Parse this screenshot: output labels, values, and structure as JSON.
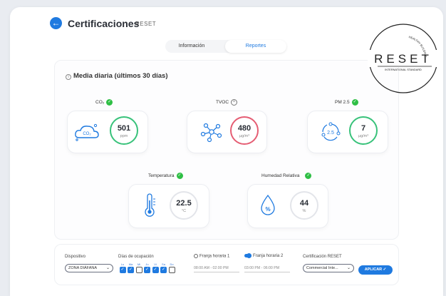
{
  "header": {
    "title": "Certificaciones",
    "subtitle": "RESET",
    "back_icon": "arrow-left-icon"
  },
  "tabs": [
    {
      "label": "Información",
      "active": false
    },
    {
      "label": "Reportes",
      "active": true
    }
  ],
  "section": {
    "title": "Media diaria (últimos 30 días)"
  },
  "metrics": {
    "co2": {
      "label": "CO₂",
      "value": "501",
      "unit": "ppm",
      "status": "ok",
      "icon": "cloud-co2-icon"
    },
    "tvoc": {
      "label": "TVOC",
      "value": "480",
      "unit": "µg/m³",
      "status": "fail",
      "icon": "molecule-icon"
    },
    "pm25": {
      "label": "PM 2.5",
      "value": "7",
      "unit": "µg/m³",
      "status": "ok",
      "icon": "particles-icon",
      "icon_text": "2.5"
    },
    "temp": {
      "label": "Temperatura",
      "value": "22.5",
      "unit": "°C",
      "status": "ok",
      "icon": "thermometer-icon"
    },
    "humidity": {
      "label": "Humedad Relativa",
      "value": "44",
      "unit": "%",
      "status": "ok",
      "icon": "water-drop-icon",
      "icon_text": "%"
    }
  },
  "filters": {
    "device_label": "Dispositivo",
    "device_value": "ZONA DIÁFANA",
    "days_label": "Días de ocupación",
    "days": [
      {
        "d": "Lu",
        "checked": true
      },
      {
        "d": "Ma",
        "checked": true
      },
      {
        "d": "Mi",
        "checked": false
      },
      {
        "d": "Ju",
        "checked": true
      },
      {
        "d": "Vi",
        "checked": true
      },
      {
        "d": "Sa",
        "checked": true
      },
      {
        "d": "Do",
        "checked": false
      }
    ],
    "slot1_label": "Franja horaria 1",
    "slot1_value": "08:00 AM - 02:00 PM",
    "slot2_label": "Franja horaria  2",
    "slot2_value": "03:00 PM - 06:00 PM",
    "cert_label": "Certificación RESET",
    "cert_value": "Commercial Inte...",
    "apply_label": "APLICAR"
  },
  "logo": {
    "text": "RESET",
    "ring_top": "HEALTHY BUILDINGS",
    "ring_bottom": "INTERNATIONAL STANDARD"
  },
  "colors": {
    "accent": "#1f7ae0",
    "ok": "#2fbf45",
    "fail_ring": "#e55d73",
    "ok_ring": "#38c27a"
  }
}
